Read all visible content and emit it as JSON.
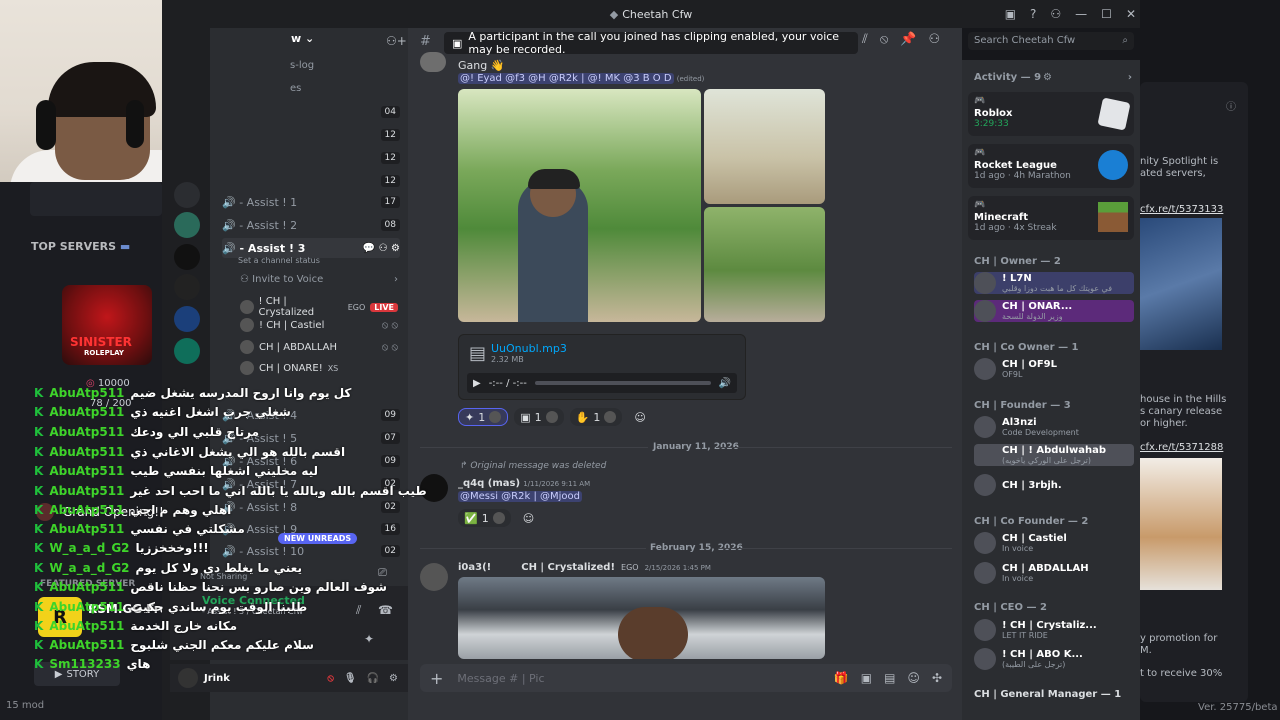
{
  "window_title": "Cheetah Cfw",
  "banner_text": "A participant in the call you joined has clipping enabled, your voice may be recorded.",
  "search_placeholder": "Search Cheetah Cfw",
  "background_site": {
    "top_servers": "TOP SERVERS",
    "server_name": "SINISTER",
    "server_sub": "ROLEPLAY",
    "members_count": "10000",
    "slots": "78 / 200",
    "grand_opening": "Grand Opening!!",
    "featured": "FEATURED SERVER",
    "rsm": "RSM.GG Free",
    "story": "STORY",
    "bottom_left": "15 mod",
    "version": "Ver. 25775/beta"
  },
  "chat_overlay": [
    {
      "user": "AbuAtp511",
      "text": "كل يوم وانا اروح المدرسه يشغل ضيم"
    },
    {
      "user": "AbuAtp511",
      "text": "شغلي جرب اشغل اغنيه ذي"
    },
    {
      "user": "AbuAtp511",
      "text": "مرتاح قلبي الي ودعك"
    },
    {
      "user": "AbuAtp511",
      "text": "اقسم بالله هو الي يشغل الاغاني ذي"
    },
    {
      "user": "AbuAtp511",
      "text": "ليه مخليني اشغلها بنفسي طيب"
    },
    {
      "user": "AbuAtp511",
      "text": "طيب اقسم بالله وبالله يا بالله اني ما احب احد غير"
    },
    {
      "user": "AbuAtp511",
      "text": "اهلي وهم م اجي"
    },
    {
      "user": "AbuAtp511",
      "text": "مشكلتي في نفسي"
    },
    {
      "user": "W_a_a_d_G2",
      "text": "وخخخززيا!!!"
    },
    {
      "user": "W_a_a_d_G2",
      "text": "يعني ما يغلط دي ولا كل يوم"
    },
    {
      "user": "AbuAtp511",
      "text": "شوف العالم وين صارو بس نحنا حظنا ناقص"
    },
    {
      "user": "AbuAtp511",
      "text": "طلبنا الوقت يوم ساندي حكيت"
    },
    {
      "user": "AbuAtp511",
      "text": "مكانه خارج الخدمة"
    },
    {
      "user": "AbuAtp511",
      "text": "سلام عليكم معكم الجني شلبوح"
    },
    {
      "user": "Sm113233",
      "text": "هاي"
    }
  ],
  "channels": [
    {
      "name": "",
      "count": "04"
    },
    {
      "name": "",
      "count": "12"
    },
    {
      "name": "",
      "count": "12"
    },
    {
      "name": "",
      "count": "12"
    },
    {
      "name": "- Assist ! 1",
      "count": "17"
    },
    {
      "name": "- Assist ! 2",
      "count": "08"
    },
    {
      "name": "- Assist ! 3",
      "count": ""
    }
  ],
  "channel_status": "Set a channel status",
  "invite_voice": "Invite to Voice",
  "voice_users": [
    {
      "name": "! CH | Crystalized",
      "badge": "EGO",
      "live": "LIVE"
    },
    {
      "name": "! CH | Castiel",
      "badge": "",
      "live": ""
    },
    {
      "name": "CH | ABDALLAH",
      "badge": "",
      "live": ""
    },
    {
      "name": "CH | ONARE!",
      "badge": "XS",
      "live": ""
    }
  ],
  "channels2": [
    {
      "name": "- Assist ! 4",
      "count": "09"
    },
    {
      "name": "- Assist ! 5",
      "count": "07"
    },
    {
      "name": "- Assist ! 6",
      "count": "09"
    },
    {
      "name": "- Assist ! 7",
      "count": "02"
    },
    {
      "name": "- Assist ! 8",
      "count": "02"
    },
    {
      "name": "- Assist ! 9",
      "count": "16"
    },
    {
      "name": "- Assist ! 10",
      "count": "02"
    }
  ],
  "new_unreads": "NEW UNREADS",
  "voice_connected": "Voice Connected",
  "voice_channel": "- Assist ! 3 / Cheetah Cfw",
  "not_sharing": "Not Sharing",
  "username": "Jrink",
  "messages": {
    "gang_text": "Gang",
    "mentions": "@! Eyad  @f3  @H  @R2k |  @!   MK @3 B O D",
    "edited": "(edited)",
    "file_name": "UuOnubl.mp3",
    "file_size": "2.32 MB",
    "time": "-:-- / -:--",
    "reactions": [
      "1",
      "1",
      "1"
    ],
    "date1": "January 11, 2026",
    "deleted": "Original message was deleted",
    "author2": "_q4q (mas)",
    "time2": "1/11/2026 9:11 AM",
    "mentions2": "@Messi  @R2k |  @Mjood",
    "react2": "1",
    "date2": "February 15, 2026",
    "author3": "i0a3(!",
    "author3b": "CH | Crystalized!",
    "badge3": "EGO",
    "time3": "2/15/2026 1:45 PM",
    "composer": "Message # | Pic"
  },
  "activity_header": "Activity — 9",
  "activities": [
    {
      "game": "Roblox",
      "detail": "3:29:33"
    },
    {
      "game": "Rocket League",
      "detail": "1d ago · 4h Marathon"
    },
    {
      "game": "Minecraft",
      "detail": "1d ago · 4x Streak"
    }
  ],
  "roles": [
    {
      "header": "CH | Owner — 2",
      "members": [
        {
          "name": "! L7N",
          "sub": "في عويتك كل ما هبت دوزا وقلبي"
        },
        {
          "name": "CH | ONAR...",
          "sub": "وزير الدولة للسحة"
        }
      ]
    },
    {
      "header": "CH | Co Owner — 1",
      "members": [
        {
          "name": "CH | OF9L",
          "sub": "OF9L"
        }
      ]
    },
    {
      "header": "CH | Founder — 3",
      "members": [
        {
          "name": "Al3nzi",
          "sub": "Code Development"
        },
        {
          "name": "CH | ! Abdulwahab",
          "sub": "(ترجل على الوركي ياخويه)"
        },
        {
          "name": "CH | 3rbjh.",
          "sub": ""
        }
      ]
    },
    {
      "header": "CH | Co Founder — 2",
      "members": [
        {
          "name": "CH | Castiel",
          "sub": "In voice"
        },
        {
          "name": "CH | ABDALLAH",
          "sub": "In voice"
        }
      ]
    },
    {
      "header": "CH | CEO — 2",
      "members": [
        {
          "name": "! CH | Crystaliz...",
          "sub": "LET IT RIDE"
        },
        {
          "name": "! CH | ABO K...",
          "sub": "(ترجل على الطيبة)"
        }
      ]
    },
    {
      "header": "CH | General Manager — 1",
      "members": []
    }
  ],
  "right_bg": {
    "t1": "nity Spotlight is",
    "t2": "ated servers,",
    "link1": "cfx.re/t/5373133",
    "t3": "house in the Hills",
    "t4": "s canary release",
    "t5": "or higher.",
    "link2": "cfx.re/t/5371288",
    "t6": "y promotion for",
    "t7": "M.",
    "t8": "t to receive 30%"
  }
}
